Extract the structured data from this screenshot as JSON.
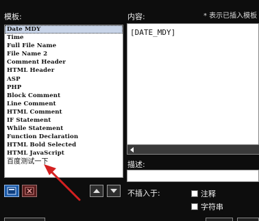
{
  "labels": {
    "templates": "模板:",
    "content": "内容:",
    "note": "* 表示已插入模板",
    "description": "描述:",
    "no_insert": "不插入于:"
  },
  "templates": [
    "Date MDY",
    "Time",
    "Full File Name",
    "File Name 2",
    "Comment Header",
    "HTML Header",
    "ASP",
    "PHP",
    "Block Comment",
    "Line Comment",
    "HTML Comment",
    "IF Statement",
    "While Statement",
    "Function Declaration",
    "HTML Bold Selected",
    "HTML JavaScript",
    "百度测试一下"
  ],
  "selected_template": "Date MDY",
  "content_text": "[DATE_MDY]",
  "description_value": "",
  "checkboxes": {
    "comment": {
      "label": "注释",
      "checked": false
    },
    "string": {
      "label": "字符串",
      "checked": false
    }
  },
  "icons": {
    "new": "new-template-icon",
    "delete": "delete-template-icon",
    "up": "move-up-icon",
    "down": "move-down-icon"
  },
  "colors": {
    "background": "#0d0d0d",
    "annotation_arrow": "#d42020",
    "selected_row": "#c8d4e8"
  }
}
